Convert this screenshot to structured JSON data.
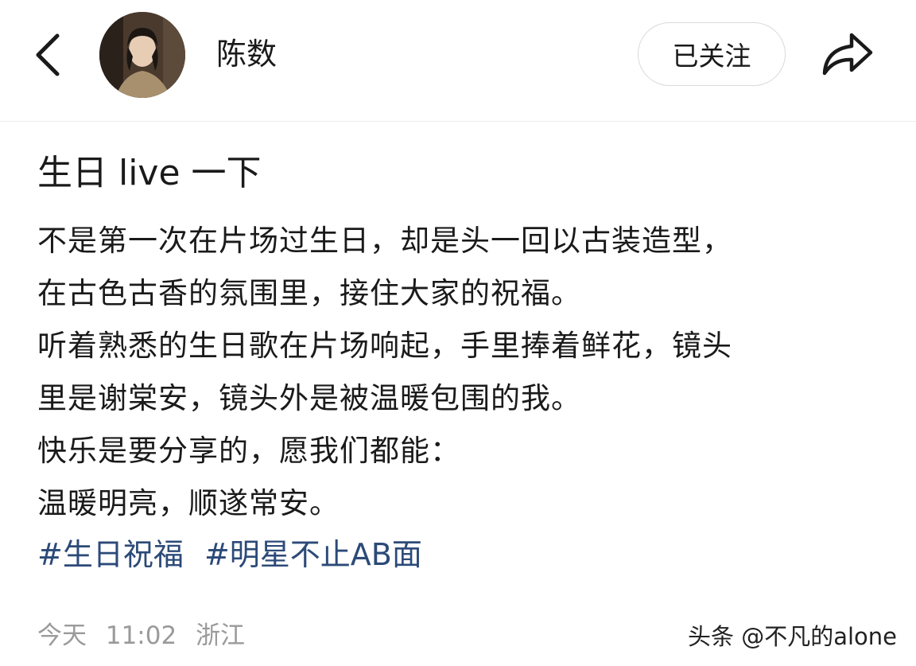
{
  "header": {
    "back_icon": "chevron-left-icon",
    "author_name": "陈数",
    "follow_label": "已关注",
    "share_icon": "share-arrow-icon"
  },
  "post": {
    "title": "生日 live 一下",
    "lines": [
      "不是第一次在片场过生日，却是头一回以古装造型，",
      "在古色古香的氛围里，接住大家的祝福。",
      "听着熟悉的生日歌在片场响起，手里捧着鲜花，镜头",
      "里是谢棠安，镜头外是被温暖包围的我。",
      "快乐是要分享的，愿我们都能：",
      "温暖明亮，顺遂常安。"
    ],
    "hashtags": [
      "#生日祝福",
      "#明星不止AB面"
    ]
  },
  "meta": {
    "date": "今天",
    "time": "11:02",
    "location": "浙江"
  },
  "watermark": "头条 @不凡的alone",
  "colors": {
    "hashtag": "#2c4a78",
    "meta_text": "#9a9a9a",
    "divider": "#ececec"
  }
}
